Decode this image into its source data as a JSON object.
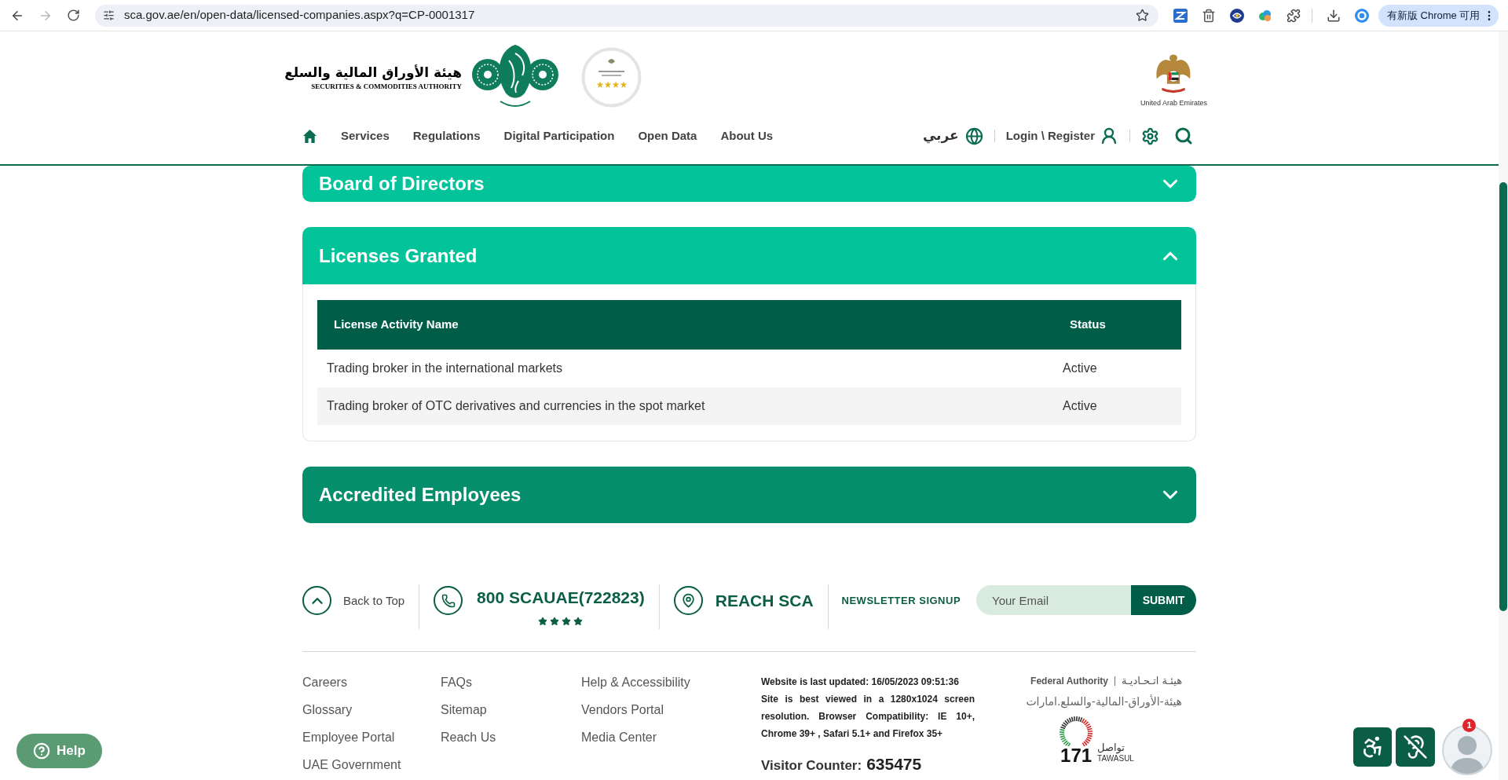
{
  "browser": {
    "url": "sca.gov.ae/en/open-data/licensed-companies.aspx?q=CP-0001317",
    "update_button": "有新版 Chrome 可用"
  },
  "header": {
    "logo_arabic": "هيئة الأوراق المالية والسلع",
    "logo_english": "SECURITIES & COMMODITIES AUTHORITY",
    "emblem_caption": "United Arab Emirates",
    "nav": [
      {
        "label": "Services"
      },
      {
        "label": "Regulations"
      },
      {
        "label": "Digital Participation"
      },
      {
        "label": "Open Data"
      },
      {
        "label": "About Us"
      }
    ],
    "language": "عربي",
    "login": "Login \\ Register"
  },
  "sections": [
    {
      "title": "Board of Directors",
      "expanded": false,
      "color": "#03c39a"
    },
    {
      "title": "Licenses Granted",
      "expanded": true,
      "color": "#03c39a",
      "table": {
        "columns": [
          "License Activity Name",
          "Status"
        ],
        "rows": [
          {
            "activity": "Trading broker in the international markets",
            "status": "Active"
          },
          {
            "activity": "Trading broker of OTC derivatives and currencies in the spot market",
            "status": "Active"
          }
        ]
      }
    },
    {
      "title": "Accredited Employees",
      "expanded": false,
      "color": "#048e6c"
    }
  ],
  "footer": {
    "back_to_top": "Back to Top",
    "phone": "800 SCAUAE(722823)",
    "stars": 4,
    "reach": "REACH SCA",
    "newsletter": {
      "label": "NEWSLETTER SIGNUP",
      "placeholder": "Your Email",
      "button": "SUBMIT"
    },
    "links": [
      [
        "Careers",
        "Glossary",
        "Employee Portal",
        "UAE Government"
      ],
      [
        "FAQs",
        "Sitemap",
        "Reach Us"
      ],
      [
        "Help & Accessibility",
        "Vendors Portal",
        "Media Center"
      ]
    ],
    "last_updated": "Website is last updated: 16/05/2023 09:51:36",
    "compatibility": "Site is best viewed in a 1280x1024 screen resolution. Browser Compatibility: IE 10+, Chrome 39+ , Safari 5.1+ and Firefox 35+",
    "visitor_label": "Visitor Counter:",
    "visitor_count": "635475",
    "federal_authority": "Federal Authority",
    "federal_authority_arabic": "هيئـة اتـحـاديـة",
    "domain_arabic": "هيئة-الأوراق-المالية-والسلع.امارات",
    "tawasul_number": "171",
    "tawasul_arabic": "تواصل",
    "tawasul": "TAWASUL"
  },
  "help_button": "Help",
  "avatar_badge": "1"
}
